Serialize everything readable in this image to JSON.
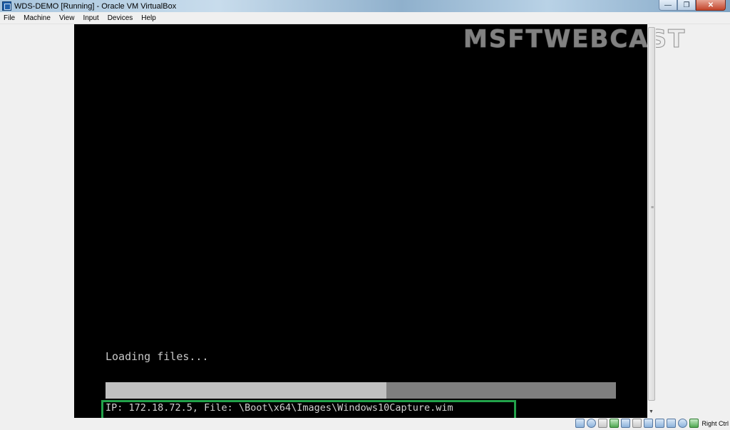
{
  "window": {
    "title": "WDS-DEMO [Running] - Oracle VM VirtualBox",
    "controls": [
      "minimize",
      "restore",
      "close"
    ]
  },
  "menu": {
    "items": [
      "File",
      "Machine",
      "View",
      "Input",
      "Devices",
      "Help"
    ]
  },
  "vm_screen": {
    "watermark": "MSFTWEBCAST",
    "loading_text": "Loading files...",
    "progress": 0.55,
    "status_line": "IP: 172.18.72.5, File: \\Boot\\x64\\Images\\Windows10Capture.wim"
  },
  "highlight": {
    "color": "#22a24a"
  },
  "statusbar": {
    "tray_icons": [
      "hard-disk-icon",
      "optical-drive-icon",
      "audio-icon",
      "network-icon",
      "usb-icon",
      "shared-folders-icon",
      "display-icon",
      "video-capture-icon",
      "virtualization-icon",
      "mouse-integration-icon",
      "keyboard-icon"
    ],
    "host_key": "Right Ctrl"
  }
}
